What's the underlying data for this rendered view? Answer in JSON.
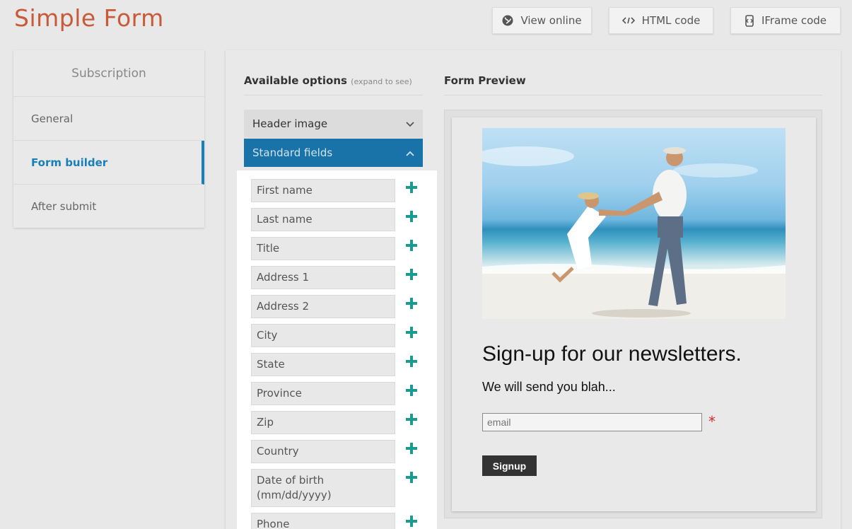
{
  "header": {
    "title": "Simple Form",
    "buttons": {
      "view_online": "View online",
      "html_code": "HTML code",
      "iframe_code": "IFrame code"
    }
  },
  "sidebar": {
    "title": "Subscription",
    "items": [
      {
        "label": "General"
      },
      {
        "label": "Form builder"
      },
      {
        "label": "After submit"
      }
    ]
  },
  "options": {
    "title": "Available options",
    "hint": "(expand to see)",
    "accordions": {
      "header_image": "Header image",
      "standard_fields": "Standard fields"
    },
    "fields": [
      {
        "label": "First name"
      },
      {
        "label": "Last name"
      },
      {
        "label": "Title"
      },
      {
        "label": "Address 1"
      },
      {
        "label": "Address 2"
      },
      {
        "label": "City"
      },
      {
        "label": "State"
      },
      {
        "label": "Province"
      },
      {
        "label": "Zip"
      },
      {
        "label": "Country"
      },
      {
        "label": "Date of birth (mm/dd/yyyy)"
      },
      {
        "label": "Phone"
      }
    ]
  },
  "preview": {
    "title": "Form Preview",
    "headline": "Sign-up for our newsletters.",
    "subtext": "We will send you blah...",
    "email_placeholder": "email",
    "required_mark": "*",
    "submit_label": "Signup"
  },
  "colors": {
    "title": "#c85a3a",
    "accent": "#1a7fb8",
    "accordion_active": "#1a73a8",
    "add_icon": "#1a9a90",
    "required": "#d02a2a"
  }
}
